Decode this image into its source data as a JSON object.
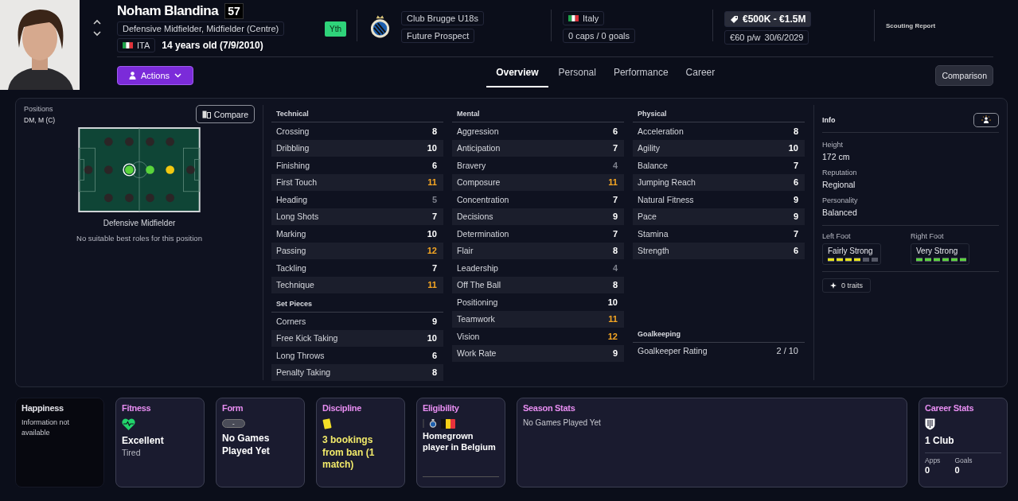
{
  "header": {
    "name": "Noham Blandina",
    "rating": "57",
    "positions": "Defensive Midfielder, Midfielder (Centre)",
    "nationality": "ITA",
    "age": "14 years old (7/9/2010)",
    "youth_badge": "Yth",
    "club": {
      "name": "Club Brugge U18s",
      "status": "Future Prospect"
    },
    "nation": {
      "name": "Italy",
      "caps": "0 caps / 0 goals"
    },
    "value": {
      "range": "€500K - €1.5M",
      "wage": "€60 p/w",
      "expiry": "30/6/2029"
    },
    "scouting_report": "Scouting Report"
  },
  "actions_button": "Actions",
  "tabs": [
    {
      "label": "Overview",
      "selected": true
    },
    {
      "label": "Personal",
      "selected": false
    },
    {
      "label": "Performance",
      "selected": false
    },
    {
      "label": "Career",
      "selected": false
    }
  ],
  "comparison_button": "Comparison",
  "positions_panel": {
    "label": "Positions",
    "value": "DM, M (C)",
    "compare_button": "Compare",
    "pitch": {
      "dots": [
        {
          "color": "#2b2526",
          "selected": false
        },
        {
          "color": "#2b2526",
          "selected": false
        },
        {
          "color": "#2b2526",
          "selected": false
        },
        {
          "color": "#2b2526",
          "selected": false
        },
        {
          "color": "#2b2526",
          "selected": false
        },
        {
          "color": "#5ad43c",
          "selected": true
        },
        {
          "color": "#2b2526",
          "selected": false
        },
        {
          "color": "#2b2526",
          "selected": false
        },
        {
          "color": "#5ad43c",
          "selected": false
        },
        {
          "color": "#2b2526",
          "selected": false
        },
        {
          "color": "#2b2526",
          "selected": false
        },
        {
          "color": "#f2c811",
          "selected": false
        },
        {
          "color": "#2b2526",
          "selected": false
        },
        {
          "color": "#2b2526",
          "selected": false
        }
      ]
    },
    "role": "Defensive Midfielder",
    "note": "No suitable best roles for this position"
  },
  "attribute_columns": [
    {
      "groups": [
        {
          "title": "Technical",
          "attributes": [
            {
              "name": "Crossing",
              "value": "8",
              "color": "#ffffff"
            },
            {
              "name": "Dribbling",
              "value": "10",
              "color": "#ffffff"
            },
            {
              "name": "Finishing",
              "value": "6",
              "color": "#ffffff"
            },
            {
              "name": "First Touch",
              "value": "11",
              "color": "#f5a623"
            },
            {
              "name": "Heading",
              "value": "5",
              "color": "#7d808c"
            },
            {
              "name": "Long Shots",
              "value": "7",
              "color": "#ffffff"
            },
            {
              "name": "Marking",
              "value": "10",
              "color": "#ffffff"
            },
            {
              "name": "Passing",
              "value": "12",
              "color": "#f5a623"
            },
            {
              "name": "Tackling",
              "value": "7",
              "color": "#ffffff"
            },
            {
              "name": "Technique",
              "value": "11",
              "color": "#f5a623"
            }
          ]
        },
        {
          "title": "Set Pieces",
          "attributes": [
            {
              "name": "Corners",
              "value": "9",
              "color": "#ffffff"
            },
            {
              "name": "Free Kick Taking",
              "value": "10",
              "color": "#ffffff"
            },
            {
              "name": "Long Throws",
              "value": "6",
              "color": "#ffffff"
            },
            {
              "name": "Penalty Taking",
              "value": "8",
              "color": "#ffffff"
            }
          ]
        }
      ]
    },
    {
      "groups": [
        {
          "title": "Mental",
          "attributes": [
            {
              "name": "Aggression",
              "value": "6",
              "color": "#ffffff"
            },
            {
              "name": "Anticipation",
              "value": "7",
              "color": "#ffffff"
            },
            {
              "name": "Bravery",
              "value": "4",
              "color": "#7d808c"
            },
            {
              "name": "Composure",
              "value": "11",
              "color": "#f5a623"
            },
            {
              "name": "Concentration",
              "value": "7",
              "color": "#ffffff"
            },
            {
              "name": "Decisions",
              "value": "9",
              "color": "#ffffff"
            },
            {
              "name": "Determination",
              "value": "7",
              "color": "#ffffff"
            },
            {
              "name": "Flair",
              "value": "8",
              "color": "#ffffff"
            },
            {
              "name": "Leadership",
              "value": "4",
              "color": "#7d808c"
            },
            {
              "name": "Off The Ball",
              "value": "8",
              "color": "#ffffff"
            },
            {
              "name": "Positioning",
              "value": "10",
              "color": "#ffffff"
            },
            {
              "name": "Teamwork",
              "value": "11",
              "color": "#f5a623"
            },
            {
              "name": "Vision",
              "value": "12",
              "color": "#f5a623"
            },
            {
              "name": "Work Rate",
              "value": "9",
              "color": "#ffffff"
            }
          ]
        }
      ]
    },
    {
      "groups": [
        {
          "title": "Physical",
          "attributes": [
            {
              "name": "Acceleration",
              "value": "8",
              "color": "#ffffff"
            },
            {
              "name": "Agility",
              "value": "10",
              "color": "#ffffff"
            },
            {
              "name": "Balance",
              "value": "7",
              "color": "#ffffff"
            },
            {
              "name": "Jumping Reach",
              "value": "6",
              "color": "#ffffff"
            },
            {
              "name": "Natural Fitness",
              "value": "9",
              "color": "#ffffff"
            },
            {
              "name": "Pace",
              "value": "9",
              "color": "#ffffff"
            },
            {
              "name": "Stamina",
              "value": "7",
              "color": "#ffffff"
            },
            {
              "name": "Strength",
              "value": "6",
              "color": "#ffffff"
            }
          ]
        },
        {
          "title": "Goalkeeping",
          "attributes": [
            {
              "name": "Goalkeeper Rating",
              "value": "2 / 10"
            }
          ]
        }
      ]
    }
  ],
  "info": {
    "title": "Info",
    "fields": [
      {
        "label": "Height",
        "value": "172 cm"
      },
      {
        "label": "Reputation",
        "value": "Regional"
      },
      {
        "label": "Personality",
        "value": "Balanced"
      }
    ],
    "feet": [
      {
        "label": "Left Foot",
        "value": "Fairly Strong",
        "level": 0.667
      },
      {
        "label": "Right Foot",
        "value": "Very Strong",
        "level": 1
      }
    ],
    "traits": "0 traits"
  },
  "cards": [
    {
      "kind": "happiness",
      "title": "Happiness",
      "text": "Information not available"
    },
    {
      "kind": "fitness",
      "title": "Fitness",
      "value": "Excellent",
      "sub": "Tired"
    },
    {
      "kind": "form",
      "title": "Form",
      "badge": "-",
      "value": "No Games Played Yet"
    },
    {
      "kind": "discipline",
      "title": "Discipline",
      "value": "3 bookings from ban (1 match)"
    },
    {
      "kind": "eligibility",
      "title": "Eligibility",
      "value": "Homegrown player in Belgium"
    },
    {
      "kind": "season",
      "title": "Season Stats",
      "text": "No Games Played Yet"
    },
    {
      "kind": "career",
      "title": "Career Stats",
      "value": "1 Club",
      "stats": [
        {
          "label": "Apps",
          "value": "0"
        },
        {
          "label": "Goals",
          "value": "0"
        }
      ]
    }
  ]
}
